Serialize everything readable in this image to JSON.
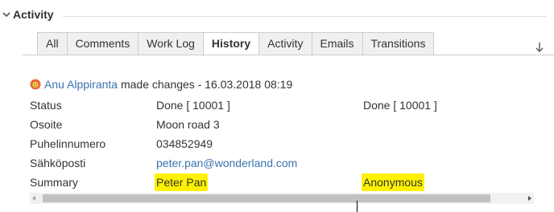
{
  "activity": {
    "title": "Activity",
    "tabs": [
      {
        "label": "All",
        "active": false
      },
      {
        "label": "Comments",
        "active": false
      },
      {
        "label": "Work Log",
        "active": false
      },
      {
        "label": "History",
        "active": true
      },
      {
        "label": "Activity",
        "active": false
      },
      {
        "label": "Emails",
        "active": false
      },
      {
        "label": "Transitions",
        "active": false
      }
    ],
    "sort_icon": "sort-down-arrow-icon"
  },
  "history": {
    "author": "Anu Alppiranta",
    "action_text": "made changes - 16.03.2018 08:19",
    "avatar_icon": "user-avatar-icon",
    "changes": [
      {
        "field": "Status",
        "old": "Done [ 10001 ]",
        "new": "Done [ 10001 ]"
      },
      {
        "field": "Osoite",
        "old": "Moon road 3",
        "new": ""
      },
      {
        "field": "Puhelinnumero",
        "old": "034852949",
        "new": ""
      },
      {
        "field": "Sähköposti",
        "old": "peter.pan@wonderland.com",
        "new": ""
      },
      {
        "field": "Summary",
        "old": "Peter Pan",
        "new": "Anonymous"
      }
    ]
  },
  "colors": {
    "link": "#3b73af",
    "highlight": "#fff200",
    "tab_bg": "#f0f0f0",
    "border": "#cccccc"
  }
}
